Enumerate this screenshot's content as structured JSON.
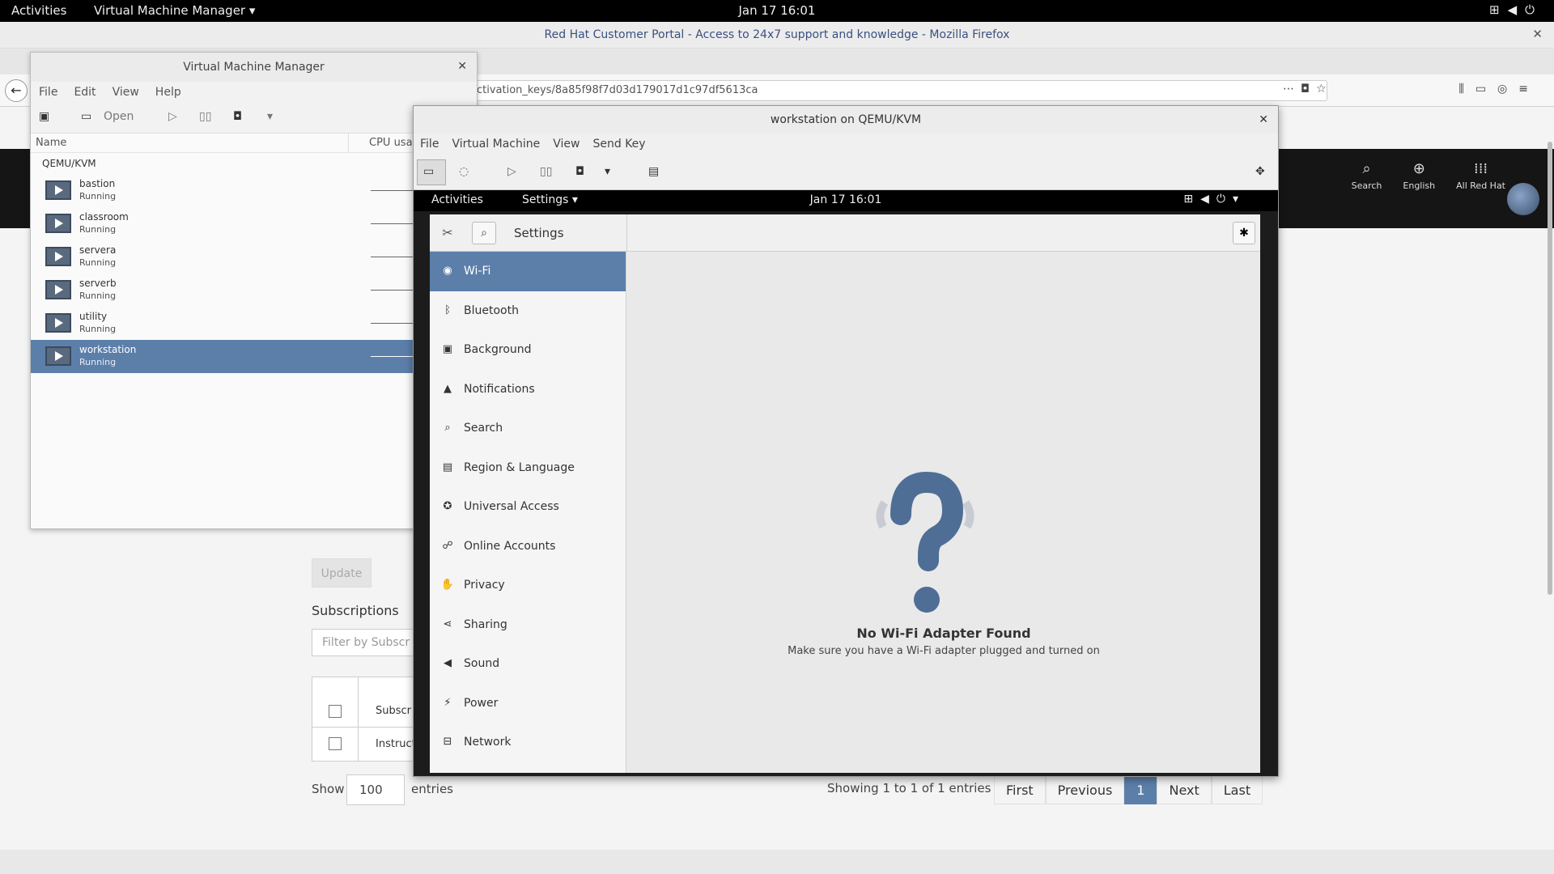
{
  "topbar": {
    "activities": "Activities",
    "app_menu": "Virtual Machine Manager ▾",
    "clock": "Jan 17  16:01"
  },
  "firefox": {
    "title": "Red Hat Customer Portal - Access to 24x7 support and knowledge - Mozilla Firefox",
    "url_fragment": "ctivation_keys/8a85f98f7d03d179017d1c97df5613ca",
    "rh_nav": [
      {
        "label": "Search",
        "icon": "search-icon"
      },
      {
        "label": "English",
        "icon": "globe-icon"
      },
      {
        "label": "All Red Hat",
        "icon": "grid-icon"
      }
    ],
    "update_label": "Update",
    "subscriptions_heading": "Subscriptions",
    "filter_placeholder": "Filter by Subscr",
    "table_header": "Subscr",
    "table_cell": "Instruct",
    "show_label": "Show",
    "show_value": "100",
    "entries_label": "entries",
    "showing_text": "Showing 1 to 1 of 1 entries",
    "pager": {
      "first": "First",
      "previous": "Previous",
      "page": "1",
      "next": "Next",
      "last": "Last"
    }
  },
  "vmm": {
    "title": "Virtual Machine Manager",
    "menu": [
      "File",
      "Edit",
      "View",
      "Help"
    ],
    "open_label": "Open",
    "col_name": "Name",
    "col_cpu": "CPU usa",
    "group": "QEMU/KVM",
    "vms": [
      {
        "name": "bastion",
        "state": "Running"
      },
      {
        "name": "classroom",
        "state": "Running"
      },
      {
        "name": "servera",
        "state": "Running"
      },
      {
        "name": "serverb",
        "state": "Running"
      },
      {
        "name": "utility",
        "state": "Running"
      },
      {
        "name": "workstation",
        "state": "Running"
      }
    ]
  },
  "console": {
    "title": "workstation on QEMU/KVM",
    "menu": [
      "File",
      "Virtual Machine",
      "View",
      "Send Key"
    ],
    "guest_topbar": {
      "activities": "Activities",
      "app": "Settings ▾",
      "clock": "Jan 17  16:01"
    }
  },
  "settings": {
    "title": "Settings",
    "items": [
      {
        "label": "Wi-Fi",
        "icon": "wifi-icon",
        "glyph": "◉"
      },
      {
        "label": "Bluetooth",
        "icon": "bluetooth-icon",
        "glyph": "ᛒ"
      },
      {
        "label": "Background",
        "icon": "background-icon",
        "glyph": "▣"
      },
      {
        "label": "Notifications",
        "icon": "bell-icon",
        "glyph": "▲"
      },
      {
        "label": "Search",
        "icon": "search-icon",
        "glyph": "⌕"
      },
      {
        "label": "Region & Language",
        "icon": "region-icon",
        "glyph": "▤"
      },
      {
        "label": "Universal Access",
        "icon": "accessibility-icon",
        "glyph": "✪"
      },
      {
        "label": "Online Accounts",
        "icon": "online-accounts-icon",
        "glyph": "☍"
      },
      {
        "label": "Privacy",
        "icon": "privacy-hand-icon",
        "glyph": "✋"
      },
      {
        "label": "Sharing",
        "icon": "share-icon",
        "glyph": "⋖"
      },
      {
        "label": "Sound",
        "icon": "speaker-icon",
        "glyph": "◀"
      },
      {
        "label": "Power",
        "icon": "power-icon",
        "glyph": "⚡"
      },
      {
        "label": "Network",
        "icon": "network-icon",
        "glyph": "⊟"
      }
    ],
    "empty_title": "No Wi-Fi Adapter Found",
    "empty_subtitle": "Make sure you have a Wi-Fi adapter plugged and turned on"
  }
}
